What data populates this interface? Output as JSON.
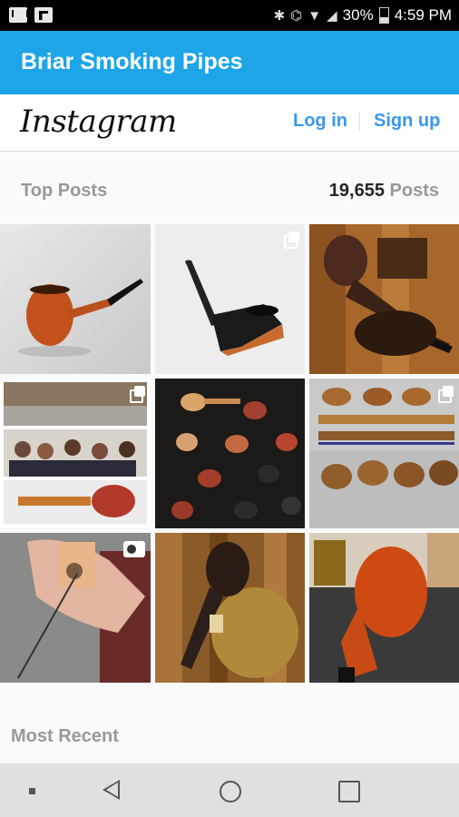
{
  "status_bar": {
    "battery": "30%",
    "time": "4:59 PM",
    "icons": [
      "mail-icon",
      "flipboard-icon",
      "bluetooth-icon",
      "cast-icon",
      "wifi-icon",
      "signal-icon",
      "battery-icon"
    ]
  },
  "app_bar": {
    "title": "Briar Smoking Pipes",
    "color": "#1da5e8"
  },
  "instagram": {
    "logo": "Instagram",
    "login_label": "Log in",
    "signup_label": "Sign up",
    "link_color": "#3897f0"
  },
  "top_posts": {
    "heading": "Top Posts",
    "count": "19,655",
    "count_suffix": "Posts",
    "tiles": [
      {
        "subject": "smooth orange briar pipe on white",
        "badge": ""
      },
      {
        "subject": "angular dark pipe on white",
        "badge": "multi-photo-icon"
      },
      {
        "subject": "rusticated pipe with tobacco on wood",
        "badge": ""
      },
      {
        "subject": "collage of workshop and people",
        "badge": "multi-photo-icon"
      },
      {
        "subject": "many pipes on dark background",
        "badge": ""
      },
      {
        "subject": "row of pipe bowls",
        "badge": "multi-photo-icon"
      },
      {
        "subject": "hand drilling pipe bowl",
        "badge": "video-icon"
      },
      {
        "subject": "rusticated pipe on tobacco",
        "badge": ""
      },
      {
        "subject": "orange sandblasted pipe on mat",
        "badge": ""
      }
    ]
  },
  "most_recent": {
    "heading": "Most Recent"
  },
  "nav_bar": {
    "icons": [
      "dot-icon",
      "back-icon",
      "home-icon",
      "recents-icon"
    ]
  }
}
